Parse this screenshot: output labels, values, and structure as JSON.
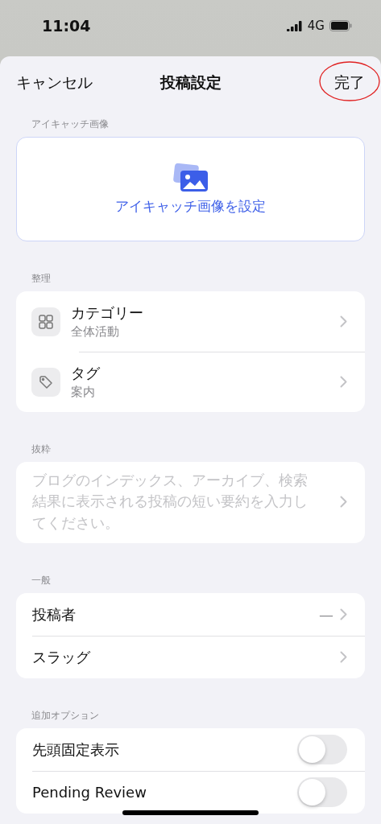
{
  "status_bar": {
    "time": "11:04",
    "network": "4G"
  },
  "nav": {
    "cancel": "キャンセル",
    "title": "投稿設定",
    "done": "完了",
    "done_highlighted": true
  },
  "sections": [
    {
      "kind": "image",
      "header": "アイキャッチ画像",
      "action": "アイキャッチ画像を設定"
    },
    {
      "kind": "list",
      "header": "整理",
      "rows": [
        {
          "kind": "category",
          "title": "カテゴリー",
          "subtitle": "全体活動"
        },
        {
          "kind": "tag",
          "title": "タグ",
          "subtitle": "案内"
        }
      ]
    },
    {
      "kind": "excerpt",
      "header": "抜粋",
      "placeholder": "ブログのインデックス、アーカイブ、検索結果に表示される投稿の短い要約を入力してください。"
    },
    {
      "kind": "list",
      "header": "一般",
      "rows": [
        {
          "title": "投稿者",
          "value": "—"
        },
        {
          "title": "スラッグ"
        }
      ]
    },
    {
      "kind": "toggles",
      "header": "追加オプション",
      "rows": [
        {
          "title": "先頭固定表示",
          "on": false
        },
        {
          "title": "Pending Review",
          "on": false
        }
      ]
    }
  ]
}
